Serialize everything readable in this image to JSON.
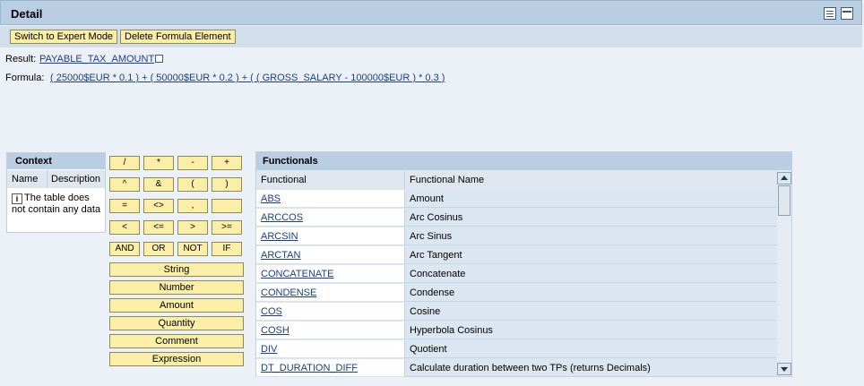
{
  "header": {
    "title": "Detail"
  },
  "toolbar": {
    "expert_mode": "Switch to Expert Mode",
    "delete_element": "Delete Formula Element"
  },
  "result": {
    "label": "Result:",
    "value": "PAYABLE_TAX_AMOUNT"
  },
  "formula": {
    "label": "Formula:",
    "value": "( 25000$EUR * 0.1 ) + ( 50000$EUR * 0.2 ) + ( ( GROSS_SALARY - 100000$EUR ) * 0.3 )"
  },
  "context": {
    "title": "Context",
    "columns": [
      "Name",
      "Description"
    ],
    "empty_message": "The table does not contain any data"
  },
  "operators": [
    "/",
    "*",
    "-",
    "+",
    "^",
    "&",
    "(",
    ")",
    "=",
    "<>",
    ",",
    "",
    "<",
    "<=",
    ">",
    ">=",
    "AND",
    "OR",
    "NOT",
    "IF"
  ],
  "value_buttons": [
    "String",
    "Number",
    "Amount",
    "Quantity",
    "Comment",
    "Expression"
  ],
  "functionals": {
    "title": "Functionals",
    "columns": [
      "Functional",
      "Functional Name"
    ],
    "rows": [
      {
        "fn": "ABS",
        "name": "Amount"
      },
      {
        "fn": "ARCCOS",
        "name": "Arc Cosinus"
      },
      {
        "fn": "ARCSIN",
        "name": "Arc Sinus"
      },
      {
        "fn": "ARCTAN",
        "name": "Arc Tangent"
      },
      {
        "fn": "CONCATENATE",
        "name": "Concatenate"
      },
      {
        "fn": "CONDENSE",
        "name": "Condense"
      },
      {
        "fn": "COS",
        "name": "Cosine"
      },
      {
        "fn": "COSH",
        "name": "Hyperbola Cosinus"
      },
      {
        "fn": "DIV",
        "name": "Quotient"
      },
      {
        "fn": "DT_DURATION_DIFF",
        "name": "Calculate duration between two TPs (returns Decimals)"
      }
    ]
  }
}
